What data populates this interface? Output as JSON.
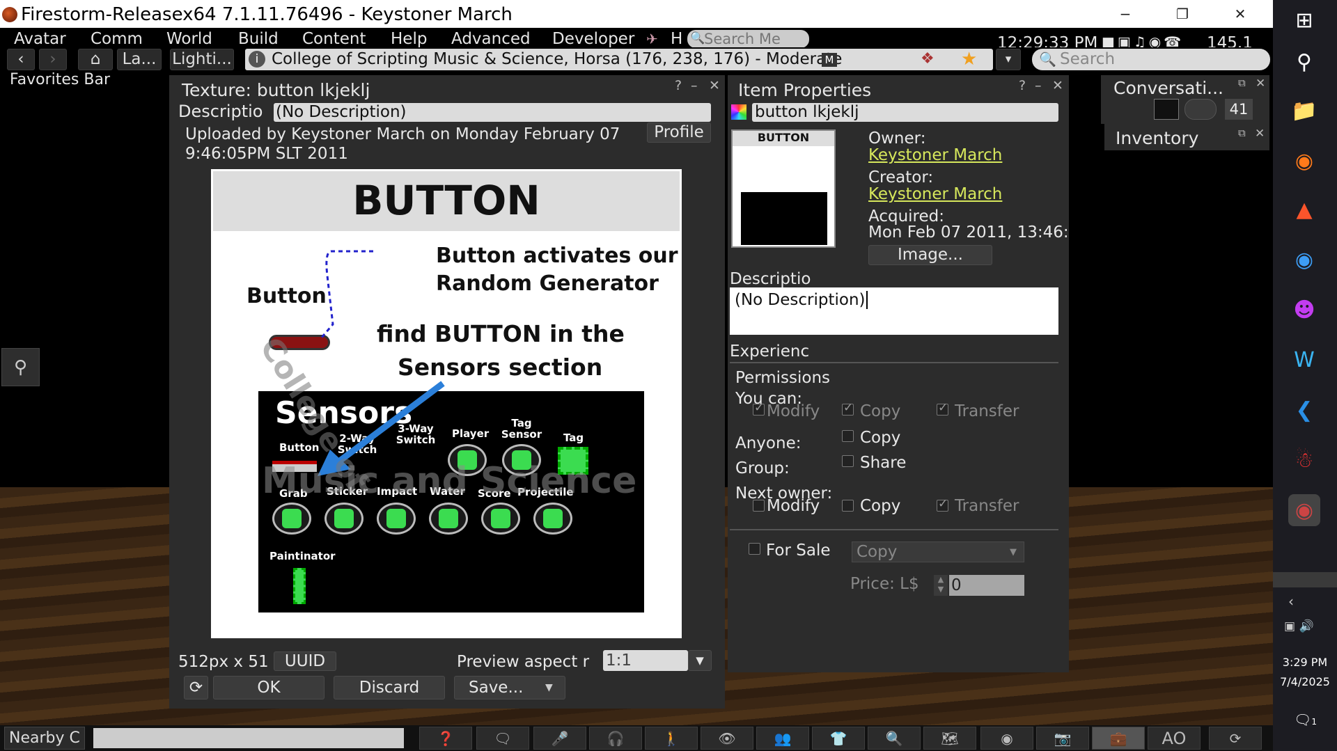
{
  "window": {
    "title": "Firestorm-Releasex64 7.1.11.76496 - Keystoner March",
    "minimize": "−",
    "restore": "❐",
    "close": "✕"
  },
  "menu": [
    "Avatar",
    "Comm",
    "World",
    "Build",
    "Content",
    "Help",
    "Advanced",
    "Developer"
  ],
  "menu_right": {
    "h_label": "H",
    "search_placeholder": "Search Me",
    "clock": "12:29:33 PM",
    "fps": "145.1"
  },
  "nav": {
    "back": "‹",
    "fwd": "›",
    "home_icon": "home-icon",
    "btn1": "La...",
    "btn2": "Lighti...",
    "location": "College of Scripting Music & Science, Horsa (176, 238, 176) - Moderate",
    "rating": "M",
    "search_placeholder": "Search"
  },
  "favorites": "Favorites Bar",
  "texture": {
    "title": "Texture: button lkjeklj",
    "help": "?",
    "min": "–",
    "close": "✕",
    "desc_label": "Descriptio",
    "desc_value": "(No Description)",
    "uploaded": "Uploaded by Keystoner March on Monday February 07",
    "uploaded2": "9:46:05PM SLT 2011",
    "profile": "Profile",
    "size": "512px x 51",
    "uuid": "UUID",
    "aspect_label": "Preview aspect r",
    "aspect_value": "1:1",
    "ok": "OK",
    "discard": "Discard",
    "save": "Save..."
  },
  "image": {
    "heading": "BUTTON",
    "t1": "Button activates our",
    "t2": "Random Generator",
    "btn": "Button",
    "t3": "find BUTTON in the",
    "t4": "Sensors section",
    "sensors": "Sensors",
    "wm1": "College of",
    "wm2": "Music and Science",
    "labels": [
      "Button",
      "2-Way Switch",
      "3-Way Switch",
      "Player",
      "Tag Sensor",
      "Tag",
      "Grab",
      "Sticker",
      "Impact",
      "Water",
      "Score",
      "Projectile",
      "Paintinator"
    ]
  },
  "item": {
    "title": "Item Properties",
    "help": "?",
    "min": "–",
    "close": "✕",
    "name": "button lkjeklj",
    "thumb_heading": "BUTTON",
    "owner_label": "Owner:",
    "owner": "Keystoner March",
    "creator_label": "Creator:",
    "creator": "Keystoner March",
    "acq_label": "Acquired:",
    "acq_value": "Mon Feb 07 2011, 13:46:",
    "image_btn": "Image...",
    "desc_label": "Descriptio",
    "desc_value": "(No Description)",
    "exp": "Experienc",
    "perms": "Permissions",
    "youcan": "You can:",
    "modify": "Modify",
    "copy": "Copy",
    "transfer": "Transfer",
    "anyone": "Anyone:",
    "group": "Group:",
    "share": "Share",
    "next_owner": "Next owner:",
    "forsale": "For Sale",
    "sale_type": "Copy",
    "price_label": "Price: L$",
    "price": "0"
  },
  "conv": {
    "title": "Conversati...",
    "count": "41"
  },
  "inventory": {
    "title": "Inventory"
  },
  "bottom": {
    "nearby": "Nearby C",
    "ao": "AO"
  },
  "taskbar": {
    "time": "3:29 PM",
    "date": "7/4/2025",
    "notif": "1"
  }
}
